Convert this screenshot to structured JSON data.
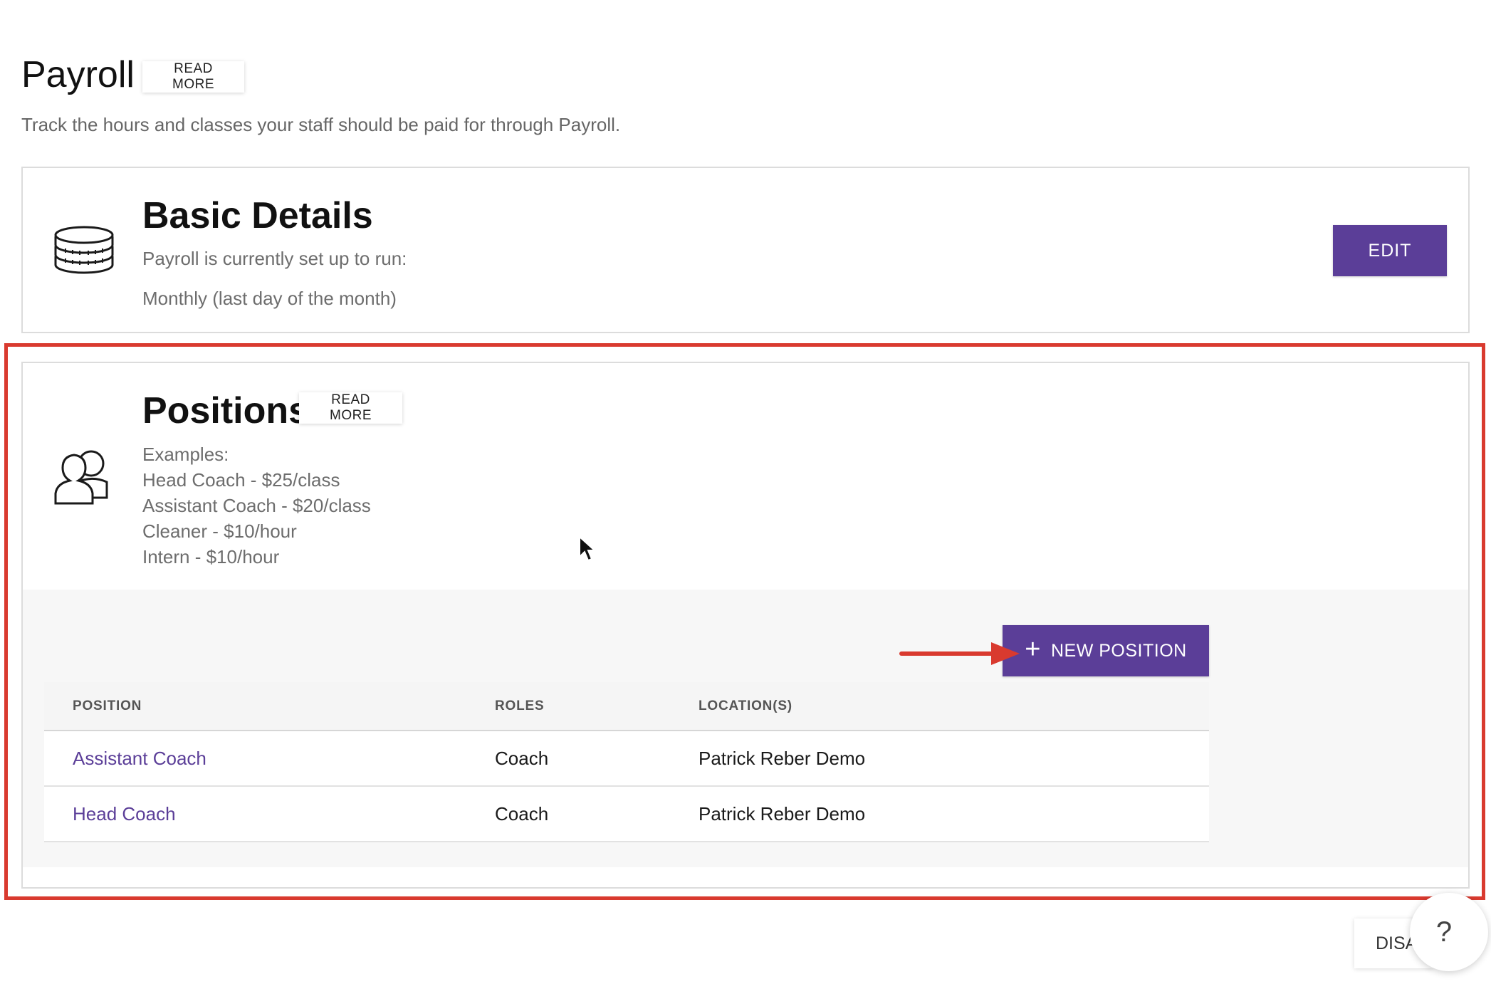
{
  "header": {
    "title": "Payroll",
    "read_more": "READ MORE",
    "subtitle": "Track the hours and classes your staff should be paid for through Payroll."
  },
  "basic_details": {
    "title": "Basic Details",
    "line1": "Payroll is currently set up to run:",
    "line2": "Monthly (last day of the month)",
    "edit_label": "EDIT",
    "icon": "coins-stack-icon"
  },
  "positions": {
    "title": "Positions",
    "read_more": "READ MORE",
    "icon": "people-icon",
    "examples": [
      "Examples:",
      "Head Coach - $25/class",
      "Assistant Coach - $20/class",
      "Cleaner - $10/hour",
      "Intern - $10/hour"
    ],
    "new_position_label": "NEW POSITION",
    "table": {
      "headers": [
        "POSITION",
        "ROLES",
        "LOCATION(S)"
      ],
      "rows": [
        [
          "Assistant Coach",
          "Coach",
          "Patrick Reber Demo"
        ],
        [
          "Head Coach",
          "Coach",
          "Patrick Reber Demo"
        ]
      ]
    }
  },
  "footer": {
    "help_label": "?",
    "dismiss_label": "DISA."
  },
  "colors": {
    "accent": "#5b3e98",
    "highlight": "#d93a2f"
  }
}
